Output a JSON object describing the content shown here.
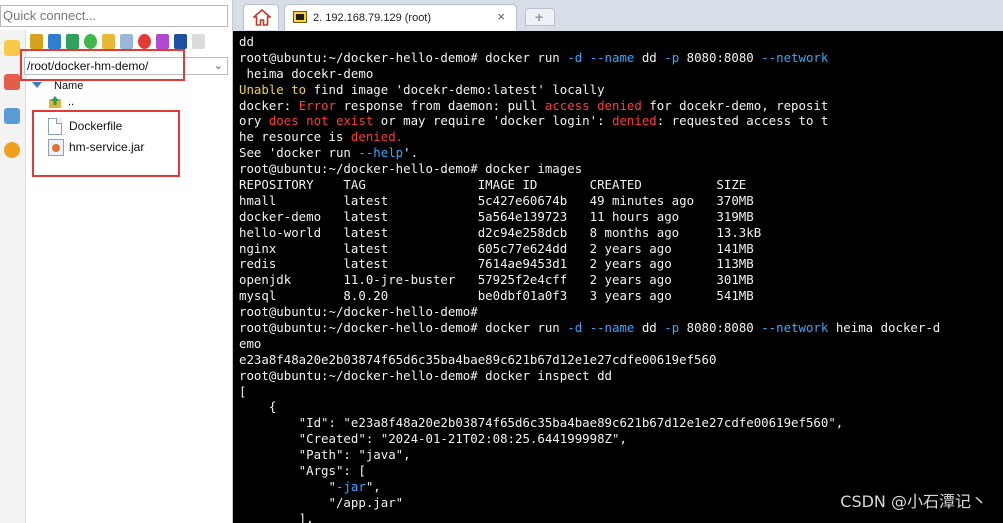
{
  "left_panel": {
    "quick_connect_placeholder": "Quick connect...",
    "path": "/root/docker-hm-demo/",
    "column_header": "Name",
    "parent_dir": "..",
    "files": [
      {
        "name": "Dockerfile",
        "icon": "document-icon"
      },
      {
        "name": "hm-service.jar",
        "icon": "java-jar-icon"
      }
    ]
  },
  "tabs": {
    "home_icon": "home-icon",
    "terminal_tab_label": "2. 192.168.79.129 (root)",
    "close_glyph": "×",
    "new_tab_glyph": "+"
  },
  "terminal": {
    "lines": [
      [
        {
          "t": "dd"
        }
      ],
      [
        {
          "t": "root@ubuntu:~/docker-hello-demo# docker run "
        },
        {
          "t": "-d",
          "c": "c"
        },
        {
          "t": " "
        },
        {
          "t": "--name",
          "c": "c"
        },
        {
          "t": " dd "
        },
        {
          "t": "-p",
          "c": "c"
        },
        {
          "t": " 8080:8080 "
        },
        {
          "t": "--network",
          "c": "c"
        }
      ],
      [
        {
          "t": " heima docekr-demo"
        }
      ],
      [
        {
          "t": "Unable to",
          "c": "y"
        },
        {
          "t": " find image 'docekr-demo:latest' locally"
        }
      ],
      [
        {
          "t": "docker: "
        },
        {
          "t": "Error",
          "c": "r"
        },
        {
          "t": " response from daemon: pull "
        },
        {
          "t": "access denied",
          "c": "r"
        },
        {
          "t": " for docekr-demo, reposit"
        }
      ],
      [
        {
          "t": "ory "
        },
        {
          "t": "does not exist",
          "c": "r"
        },
        {
          "t": " or may require 'docker login': "
        },
        {
          "t": "denied",
          "c": "r"
        },
        {
          "t": ": requested access to t"
        }
      ],
      [
        {
          "t": "he resource is "
        },
        {
          "t": "denied.",
          "c": "r"
        }
      ],
      [
        {
          "t": "See 'docker run "
        },
        {
          "t": "--help",
          "c": "c"
        },
        {
          "t": "'."
        }
      ],
      [
        {
          "t": "root@ubuntu:~/docker-hello-demo# docker images"
        }
      ],
      [
        {
          "t": "REPOSITORY    TAG               IMAGE ID       CREATED          SIZE"
        }
      ],
      [
        {
          "t": "hmall         latest            5c427e60674b   49 minutes ago   370MB"
        }
      ],
      [
        {
          "t": "docker-demo   latest            5a564e139723   11 hours ago     319MB"
        }
      ],
      [
        {
          "t": "hello-world   latest            d2c94e258dcb   8 months ago     13.3kB"
        }
      ],
      [
        {
          "t": "nginx         latest            605c77e624dd   2 years ago      141MB"
        }
      ],
      [
        {
          "t": "redis         latest            7614ae9453d1   2 years ago      113MB"
        }
      ],
      [
        {
          "t": "openjdk       11.0-jre-buster   57925f2e4cff   2 years ago      301MB"
        }
      ],
      [
        {
          "t": "mysql         8.0.20            be0dbf01a0f3   3 years ago      541MB"
        }
      ],
      [
        {
          "t": "root@ubuntu:~/docker-hello-demo#"
        }
      ],
      [
        {
          "t": "root@ubuntu:~/docker-hello-demo# docker run "
        },
        {
          "t": "-d",
          "c": "c"
        },
        {
          "t": " "
        },
        {
          "t": "--name",
          "c": "c"
        },
        {
          "t": " dd "
        },
        {
          "t": "-p",
          "c": "c"
        },
        {
          "t": " 8080:8080 "
        },
        {
          "t": "--network",
          "c": "c"
        },
        {
          "t": " heima docker-d"
        }
      ],
      [
        {
          "t": "emo"
        }
      ],
      [
        {
          "t": "e23a8f48a20e2b03874f65d6c35ba4bae89c621b67d12e1e27cdfe00619ef560"
        }
      ],
      [
        {
          "t": "root@ubuntu:~/docker-hello-demo# docker inspect dd"
        }
      ],
      [
        {
          "t": "["
        }
      ],
      [
        {
          "t": "    {"
        }
      ],
      [
        {
          "t": "        \"Id\": \"e23a8f48a20e2b03874f65d6c35ba4bae89c621b67d12e1e27cdfe00619ef560\","
        }
      ],
      [
        {
          "t": "        \"Created\": \"2024-01-21T02:08:25.644199998Z\","
        }
      ],
      [
        {
          "t": "        \"Path\": \"java\","
        }
      ],
      [
        {
          "t": "        \"Args\": ["
        }
      ],
      [
        {
          "t": "            \""
        },
        {
          "t": "-jar",
          "c": "c"
        },
        {
          "t": "\","
        }
      ],
      [
        {
          "t": "            \"/app.jar\""
        }
      ],
      [
        {
          "t": "        ],"
        }
      ]
    ]
  },
  "watermark": "CSDN @小石潭记丶",
  "colors": {
    "terminal_bg": "#000000",
    "warning_yellow": "#f0d43a",
    "error_red": "#ff3b3b",
    "option_cyan": "#32a9ff",
    "highlight_box": "#e53935"
  }
}
